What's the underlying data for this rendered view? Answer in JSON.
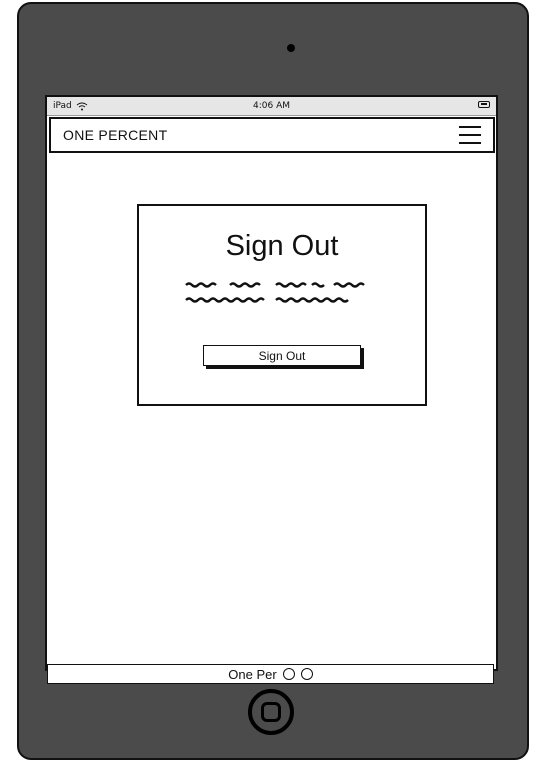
{
  "statusbar": {
    "device": "iPad",
    "time": "4:06 AM",
    "wifi_icon": "wifi-icon",
    "battery_icon": "battery-icon"
  },
  "navbar": {
    "brand": "ONE PERCENT",
    "menu_icon": "hamburger-menu-icon"
  },
  "card": {
    "title": "Sign Out",
    "button_label": "Sign Out"
  },
  "footer": {
    "text": "One Per"
  }
}
